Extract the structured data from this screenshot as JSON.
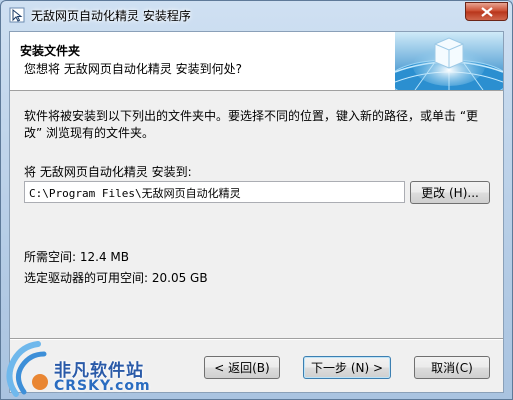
{
  "window": {
    "title": "无敌网页自动化精灵 安装程序"
  },
  "header": {
    "title": "安装文件夹",
    "subtitle": "您想将 无敌网页自动化精灵 安装到何处?"
  },
  "body": {
    "instructions": "软件将被安装到以下列出的文件夹中。要选择不同的位置，键入新的路径，或单击 “更改” 浏览现有的文件夹。",
    "install_label": "将 无敌网页自动化精灵 安装到:",
    "install_path": "C:\\Program Files\\无敌网页自动化精灵",
    "browse_label": "更改",
    "browse_accel": "(H)...",
    "space_required": "所需空间: 12.4 MB",
    "space_available": "选定驱动器的可用空间: 20.05 GB"
  },
  "buttons": {
    "back_label": "< 返回",
    "back_accel": "(B)",
    "next_label": "下一步",
    "next_accel": "(N) >",
    "cancel_label": "取消",
    "cancel_accel": "(C)"
  },
  "watermark": {
    "cn": "非凡软件站",
    "en": "CRSKY.com"
  },
  "colors": {
    "accent": "#3c7fb1",
    "close_button": "#c9482c",
    "watermark": "#2a5aa8"
  },
  "icons": [
    "app-icon",
    "close-icon",
    "header-globe-icon",
    "watermark-logo-icon"
  ]
}
